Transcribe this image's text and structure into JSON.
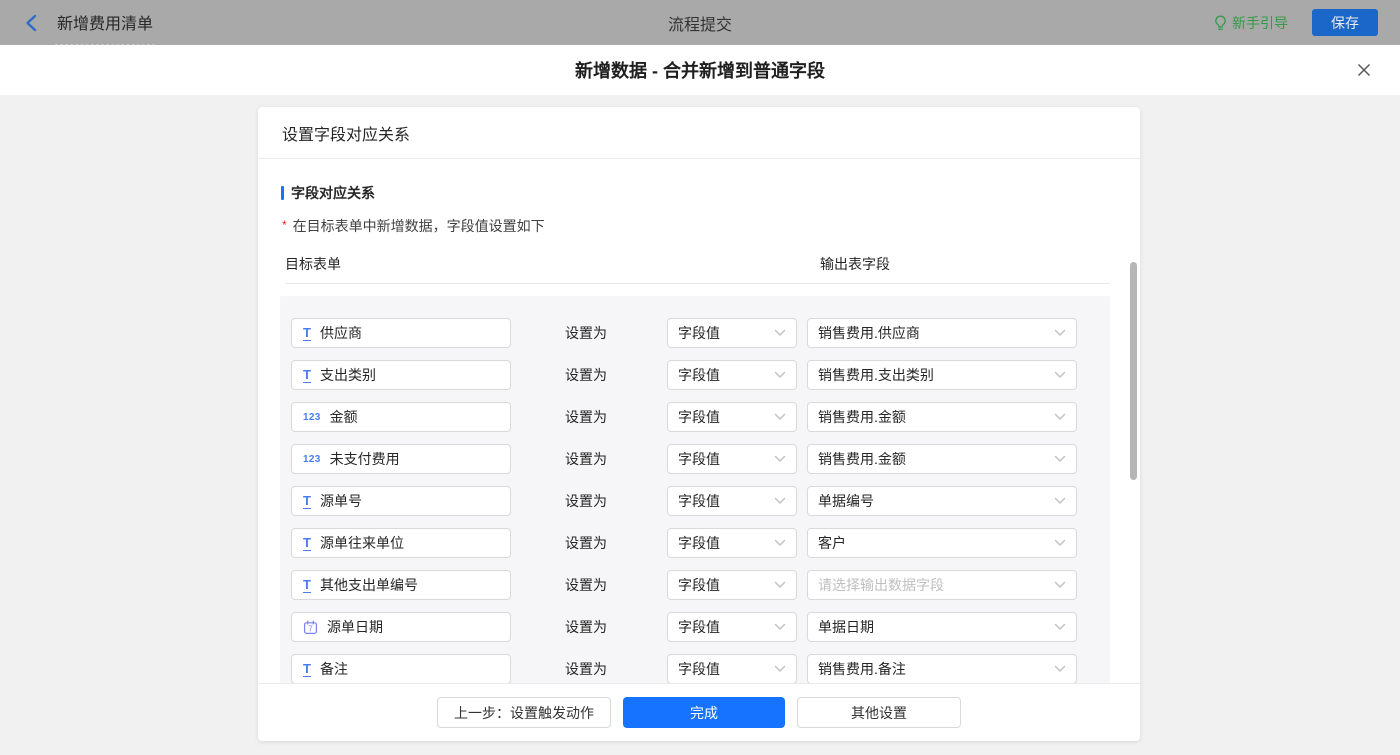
{
  "topbar": {
    "back_label": "新增费用清单",
    "center_title": "流程提交",
    "guide_label": "新手引导",
    "save_label": "保存"
  },
  "dialog": {
    "title": "新增数据 - 合并新增到普通字段"
  },
  "panel": {
    "header": "设置字段对应关系",
    "section_title": "字段对应关系",
    "required_mark": "*",
    "note": "在目标表单中新增数据，字段值设置如下",
    "columns": {
      "target": "目标表单",
      "output": "输出表字段"
    },
    "set_as_label": "设置为",
    "output_placeholder": "请选择输出数据字段",
    "rows": [
      {
        "icon": "text",
        "target": "供应商",
        "method": "字段值",
        "output": "销售费用.供应商",
        "is_placeholder": false
      },
      {
        "icon": "text",
        "target": "支出类别",
        "method": "字段值",
        "output": "销售费用.支出类别",
        "is_placeholder": false
      },
      {
        "icon": "number",
        "target": "金额",
        "method": "字段值",
        "output": "销售费用.金额",
        "is_placeholder": false
      },
      {
        "icon": "number",
        "target": "未支付费用",
        "method": "字段值",
        "output": "销售费用.金额",
        "is_placeholder": false
      },
      {
        "icon": "text",
        "target": "源单号",
        "method": "字段值",
        "output": "单据编号",
        "is_placeholder": false
      },
      {
        "icon": "text",
        "target": "源单往来单位",
        "method": "字段值",
        "output": "客户",
        "is_placeholder": false
      },
      {
        "icon": "text",
        "target": "其他支出单编号",
        "method": "字段值",
        "output": "请选择输出数据字段",
        "is_placeholder": true
      },
      {
        "icon": "date",
        "target": "源单日期",
        "method": "字段值",
        "output": "单据日期",
        "is_placeholder": false
      },
      {
        "icon": "text",
        "target": "备注",
        "method": "字段值",
        "output": "销售费用.备注",
        "is_placeholder": false
      }
    ]
  },
  "footer": {
    "prev_label": "上一步：设置触发动作",
    "finish_label": "完成",
    "other_label": "其他设置"
  },
  "colors": {
    "accent_blue": "#1673ff",
    "dimmed_save_blue": "#1b66c9",
    "guide_green": "#359a47",
    "required_red": "#f5222d",
    "field_icon_blue": "#4a7cf0",
    "topbar_dimmed_gray": "#a9a9a9"
  }
}
